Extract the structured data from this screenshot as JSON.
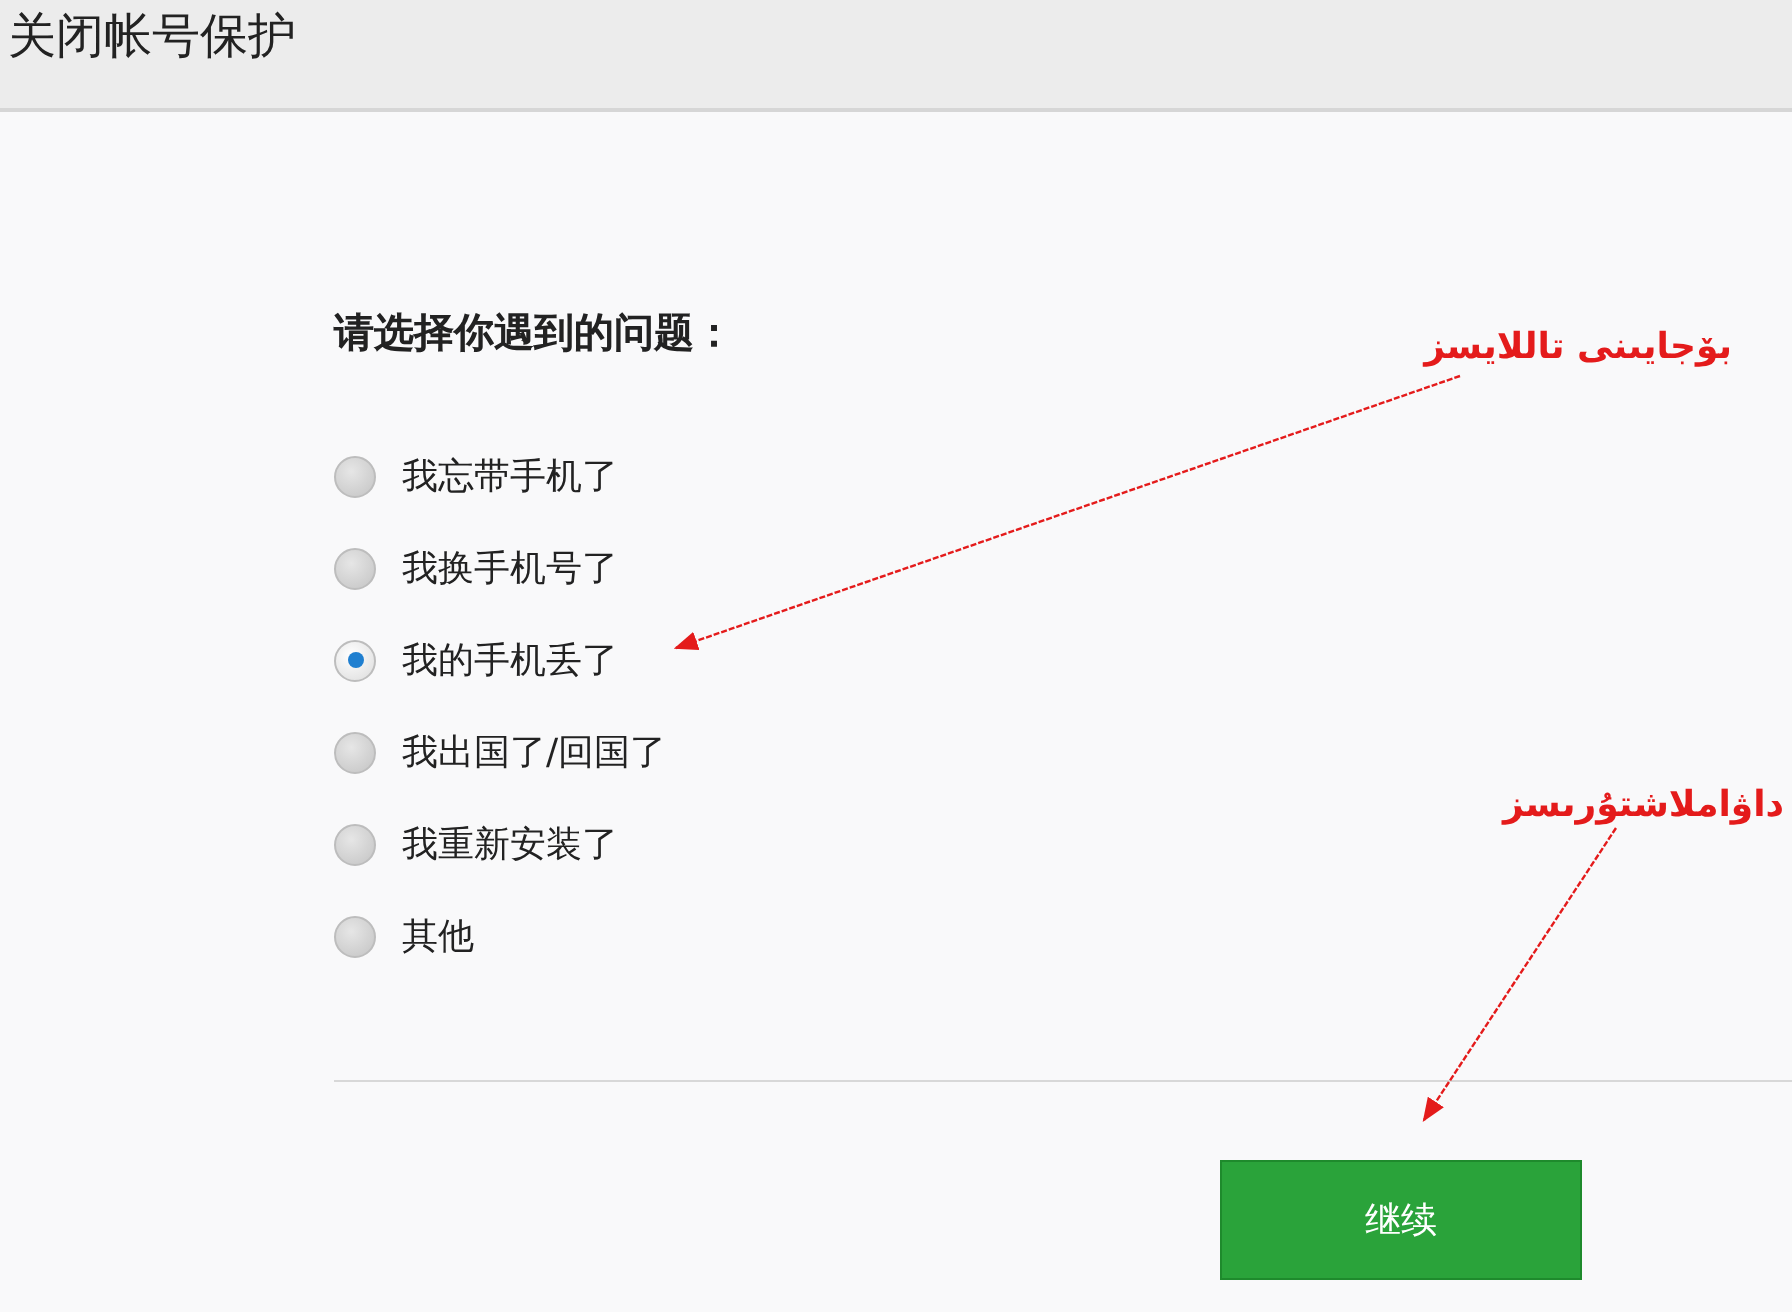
{
  "header": {
    "title": "关闭帐号保护"
  },
  "question": "请选择你遇到的问题：",
  "options": [
    {
      "label": "我忘带手机了",
      "selected": false
    },
    {
      "label": "我换手机号了",
      "selected": false
    },
    {
      "label": "我的手机丢了",
      "selected": true
    },
    {
      "label": "我出国了/回国了",
      "selected": false
    },
    {
      "label": "我重新安装了",
      "selected": false
    },
    {
      "label": "其他",
      "selected": false
    }
  ],
  "continue_button": "继续",
  "annotations": [
    {
      "text": "بۆجايىنى  تاللايسز"
    },
    {
      "text": "داۋاملاشتۇرىسز"
    }
  ]
}
